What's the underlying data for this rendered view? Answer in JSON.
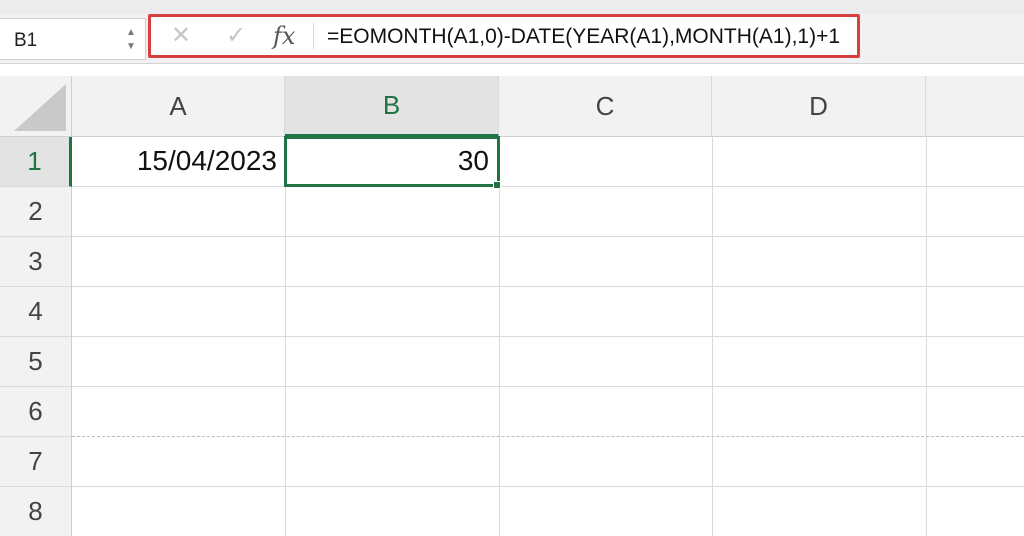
{
  "name_box": {
    "value": "B1"
  },
  "formula_bar": {
    "cancel_icon": "✕",
    "confirm_icon": "✓",
    "fx_label": "fx",
    "formula": "=EOMONTH(A1,0)-DATE(YEAR(A1),MONTH(A1),1)+1"
  },
  "columns": [
    "A",
    "B",
    "C",
    "D"
  ],
  "rows": [
    "1",
    "2",
    "3",
    "4",
    "5",
    "6",
    "7",
    "8"
  ],
  "cells": {
    "A1": "15/04/2023",
    "B1": "30"
  },
  "selection": {
    "cell": "B1",
    "column": "B",
    "row": "1"
  },
  "colors": {
    "selection_green": "#217346",
    "highlight_border": "#d8403f"
  }
}
